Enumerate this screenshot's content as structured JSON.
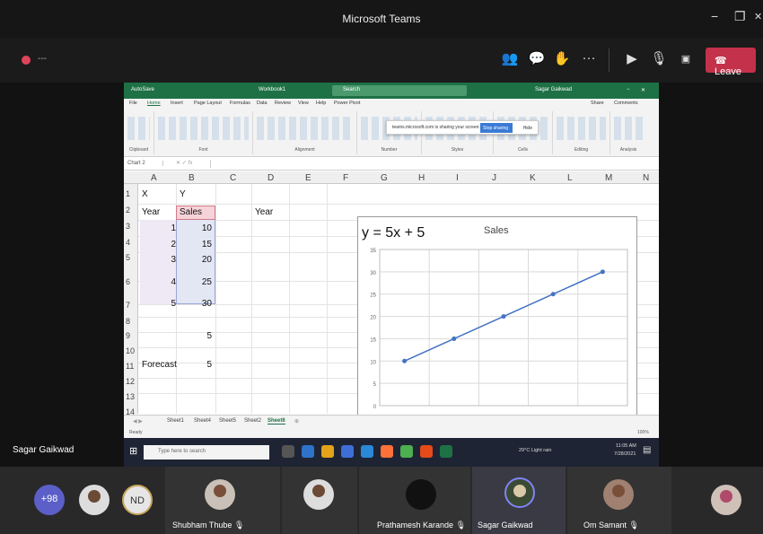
{
  "teams": {
    "window_title": "Microsoft Teams",
    "minimize": "−",
    "maximize": "❐",
    "close": "✕",
    "call_time": "---",
    "leave_label": "Leave",
    "presenter_name": "Sagar Gaikwad"
  },
  "excel": {
    "autosave": "AutoSave",
    "file_name": "Workbook1",
    "search_placeholder": "Search",
    "user_name": "Sagar Gaikwad",
    "ribbon_tabs": [
      "File",
      "Home",
      "Insert",
      "Page Layout",
      "Formulas",
      "Data",
      "Review",
      "View",
      "Help",
      "Power Pivot"
    ],
    "share_label": "Share",
    "comments_label": "Comments",
    "ribbon_groups": [
      "Clipboard",
      "Font",
      "Alignment",
      "Number",
      "Styles",
      "Cells",
      "Editing",
      "Analysis"
    ],
    "sharing_notice": "teams.microsoft.com is sharing your screen.",
    "stop_sharing": "Stop sharing",
    "hide": "Hide",
    "name_box": "Chart 2",
    "columns": [
      "A",
      "B",
      "C",
      "D",
      "E",
      "F",
      "G",
      "H",
      "I",
      "J",
      "K",
      "L",
      "M",
      "N"
    ],
    "rows": [
      "1",
      "2",
      "3",
      "4",
      "5",
      "6",
      "7",
      "8",
      "9",
      "10",
      "11",
      "12",
      "13",
      "14"
    ],
    "cells": {
      "a1": "X",
      "b1": "Y",
      "a2": "Year",
      "b2": "Sales",
      "d2": "Year",
      "a3": "1",
      "b3": "10",
      "a4": "2",
      "b4": "15",
      "a5": "3",
      "b5": "20",
      "a6": "4",
      "b6": "25",
      "a7": "5",
      "b7": "30",
      "b9": "5",
      "a11": "Forecast",
      "b11": "5"
    },
    "sheet_tabs": [
      "Sheet1",
      "Sheet4",
      "Sheet5",
      "Sheet2",
      "Sheet6"
    ],
    "ready": "Ready",
    "zoom": "100%"
  },
  "chart_data": {
    "type": "line",
    "title": "Sales",
    "annotation": "y = 5x + 5",
    "x": [
      1,
      2,
      3,
      4,
      5
    ],
    "series": [
      {
        "name": "Sales",
        "values": [
          10,
          15,
          20,
          25,
          30
        ]
      }
    ],
    "ylim": [
      0,
      35
    ],
    "yticks": [
      0,
      5,
      10,
      15,
      20,
      25,
      30,
      35
    ],
    "grid": true,
    "colors": {
      "line": "#4472c4"
    }
  },
  "windows_taskbar": {
    "search_placeholder": "Type here to search",
    "weather": "29°C Light rain",
    "time": "11:05 AM",
    "date": "7/28/2021"
  },
  "participants": {
    "overflow_count": "+98",
    "initials": "ND",
    "names": [
      "Shubham Thube",
      "Prathamesh Karande",
      "Sagar Gaikwad",
      "Om Samant"
    ]
  }
}
